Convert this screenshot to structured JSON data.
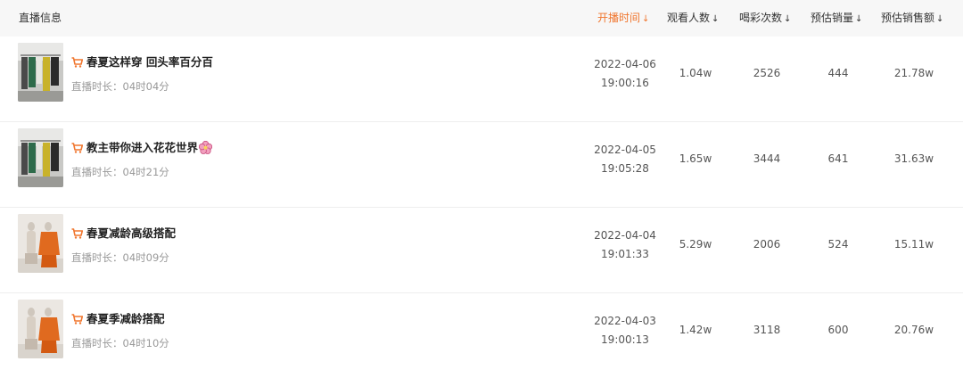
{
  "header": {
    "info_label": "直播信息",
    "columns": [
      {
        "label": "开播时间",
        "arrow": "↓",
        "active": true
      },
      {
        "label": "观看人数",
        "arrow": "↓",
        "active": false
      },
      {
        "label": "喝彩次数",
        "arrow": "↓",
        "active": false
      },
      {
        "label": "预估销量",
        "arrow": "↓",
        "active": false
      },
      {
        "label": "预估销售额",
        "arrow": "↓",
        "active": false
      }
    ]
  },
  "rows": [
    {
      "title": "春夏这样穿 回头率百分百",
      "duration": "直播时长：04时04分",
      "date": "2022-04-06",
      "time": "19:00:16",
      "viewers": "1.04w",
      "cheers": "2526",
      "sales": "444",
      "revenue": "21.78w"
    },
    {
      "title": "教主带你进入花花世界",
      "duration": "直播时长：04时21分",
      "date": "2022-04-05",
      "time": "19:05:28",
      "viewers": "1.65w",
      "cheers": "3444",
      "sales": "641",
      "revenue": "31.63w"
    },
    {
      "title": "春夏减龄高级搭配",
      "duration": "直播时长：04时09分",
      "date": "2022-04-04",
      "time": "19:01:33",
      "viewers": "5.29w",
      "cheers": "2006",
      "sales": "524",
      "revenue": "15.11w"
    },
    {
      "title": "春夏季减龄搭配",
      "duration": "直播时长：04时10分",
      "date": "2022-04-03",
      "time": "19:00:13",
      "viewers": "1.42w",
      "cheers": "3118",
      "sales": "600",
      "revenue": "20.76w"
    }
  ],
  "colors": {
    "accent": "#f0762e",
    "header_bg": "#f7f7f7"
  }
}
